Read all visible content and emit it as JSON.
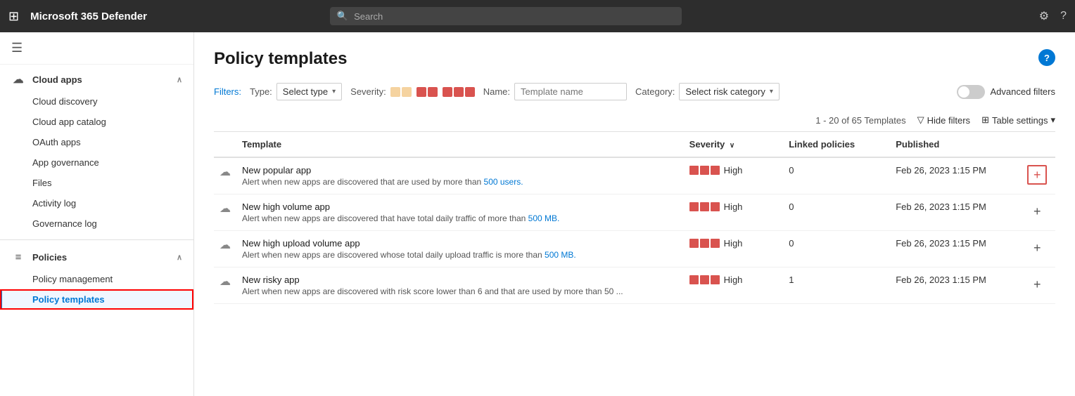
{
  "topbar": {
    "title": "Microsoft 365 Defender",
    "search_placeholder": "Search"
  },
  "sidebar": {
    "hamburger_label": "☰",
    "cloud_apps_label": "Cloud apps",
    "cloud_discovery_label": "Cloud discovery",
    "cloud_app_catalog_label": "Cloud app catalog",
    "oauth_apps_label": "OAuth apps",
    "app_governance_label": "App governance",
    "files_label": "Files",
    "activity_log_label": "Activity log",
    "governance_log_label": "Governance log",
    "policies_label": "Policies",
    "policy_management_label": "Policy management",
    "policy_templates_label": "Policy templates"
  },
  "main": {
    "page_title": "Policy templates",
    "filters_label": "Filters:",
    "type_label": "Type:",
    "type_value": "Select type",
    "severity_label": "Severity:",
    "name_label": "Name:",
    "name_placeholder": "Template name",
    "category_label": "Category:",
    "category_value": "Select risk category",
    "advanced_filters_label": "Advanced filters",
    "table_count": "1 - 20 of 65 Templates",
    "hide_filters_label": "Hide filters",
    "table_settings_label": "Table settings",
    "col_template": "Template",
    "col_severity": "Severity",
    "col_linked": "Linked policies",
    "col_published": "Published",
    "rows": [
      {
        "name": "New popular app",
        "desc_before": "Alert when new apps are discovered that are used by more than ",
        "desc_link": "500 users.",
        "desc_after": "",
        "severity": "High",
        "linked": "0",
        "published": "Feb 26, 2023 1:15 PM",
        "highlight": true
      },
      {
        "name": "New high volume app",
        "desc_before": "Alert when new apps are discovered that have total daily traffic of more than ",
        "desc_link": "500 MB.",
        "desc_after": "",
        "severity": "High",
        "linked": "0",
        "published": "Feb 26, 2023 1:15 PM",
        "highlight": false
      },
      {
        "name": "New high upload volume app",
        "desc_before": "Alert when new apps are discovered whose total daily upload traffic is more than ",
        "desc_link": "500 MB.",
        "desc_after": "",
        "severity": "High",
        "linked": "0",
        "published": "Feb 26, 2023 1:15 PM",
        "highlight": false
      },
      {
        "name": "New risky app",
        "desc_before": "Alert when new apps are discovered with risk score lower than 6 and that are used by more than 50 ...",
        "desc_link": "",
        "desc_after": "",
        "severity": "High",
        "linked": "1",
        "published": "Feb 26, 2023 1:15 PM",
        "highlight": false
      }
    ]
  }
}
